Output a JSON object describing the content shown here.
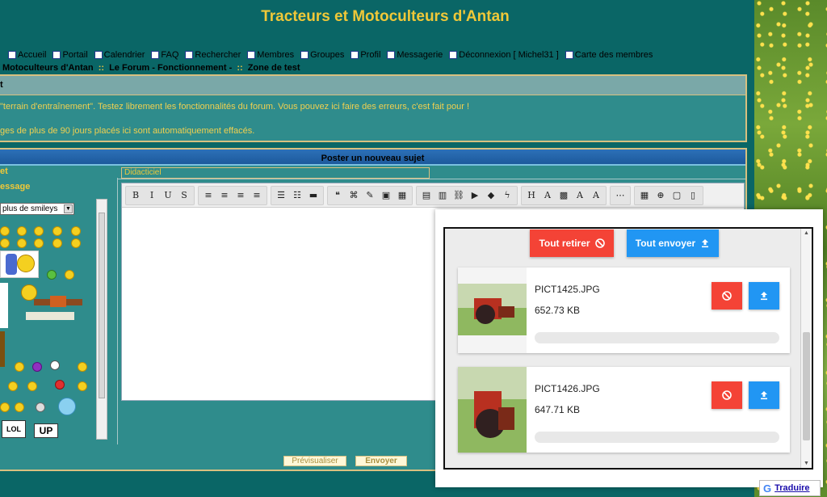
{
  "page": {
    "title": "Tracteurs et Motoculteurs d'Antan"
  },
  "nav": [
    {
      "icon": "home-icon",
      "label": "Accueil"
    },
    {
      "icon": "portal-icon",
      "label": "Portail"
    },
    {
      "icon": "calendar-icon",
      "label": "Calendrier"
    },
    {
      "icon": "faq-icon",
      "label": "FAQ"
    },
    {
      "icon": "search-icon",
      "label": "Rechercher"
    },
    {
      "icon": "members-icon",
      "label": "Membres"
    },
    {
      "icon": "groups-icon",
      "label": "Groupes"
    },
    {
      "icon": "profile-icon",
      "label": "Profil"
    },
    {
      "icon": "mail-icon",
      "label": "Messagerie"
    },
    {
      "icon": "logout-icon",
      "label": "Déconnexion [ Michel31 ]"
    },
    {
      "icon": "globe-icon",
      "label": "Carte des membres"
    }
  ],
  "breadcrumb": {
    "item1": "Motoculteurs d'Antan",
    "item2": "Le Forum - Fonctionnement -",
    "item3": "Zone de test",
    "sep": "::"
  },
  "forum": {
    "head": "t",
    "desc1": "\"terrain d'entraînement\". Testez librement les fonctionnalités du forum. Vous pouvez ici faire des erreurs, c'est fait pour !",
    "desc2": "ges de plus de 90 jours placés ici sont automatiquement effacés."
  },
  "post": {
    "header": "Poster un nouveau sujet",
    "subject_label": "et",
    "message_label": "essage",
    "subject_value": "Didacticiel",
    "smiley_select": "plus de smileys",
    "preview_button": "Prévisualiser",
    "send_button": "Envoyer"
  },
  "toolbar": {
    "groups": [
      [
        {
          "n": "bold-icon",
          "g": "B"
        },
        {
          "n": "italic-icon",
          "g": "I"
        },
        {
          "n": "underline-icon",
          "g": "U"
        },
        {
          "n": "strike-icon",
          "g": "S"
        }
      ],
      [
        {
          "n": "align-left-icon",
          "g": "≡"
        },
        {
          "n": "align-center-icon",
          "g": "≡"
        },
        {
          "n": "align-right-icon",
          "g": "≡"
        },
        {
          "n": "justify-icon",
          "g": "≡"
        }
      ],
      [
        {
          "n": "bullet-list-icon",
          "g": "☰"
        },
        {
          "n": "number-list-icon",
          "g": "☷"
        },
        {
          "n": "hr-icon",
          "g": "▬"
        }
      ],
      [
        {
          "n": "quote-icon",
          "g": "❝"
        },
        {
          "n": "code-icon",
          "g": "⌘"
        },
        {
          "n": "spoiler-icon",
          "g": "✎"
        },
        {
          "n": "hide-icon",
          "g": "▣"
        },
        {
          "n": "table-icon",
          "g": "▦"
        }
      ],
      [
        {
          "n": "image-icon",
          "g": "▤"
        },
        {
          "n": "host-image-icon",
          "g": "▥"
        },
        {
          "n": "link-icon",
          "g": "⛓"
        },
        {
          "n": "youtube-icon",
          "g": "▶"
        },
        {
          "n": "dailymotion-icon",
          "g": "◆"
        },
        {
          "n": "flash-icon",
          "g": "ϟ"
        }
      ],
      [
        {
          "n": "heading-icon",
          "g": "H"
        },
        {
          "n": "font-icon",
          "g": "A"
        },
        {
          "n": "color-icon",
          "g": "▩"
        },
        {
          "n": "font-style-icon",
          "g": "A"
        },
        {
          "n": "clear-format-icon",
          "g": "A"
        }
      ],
      [
        {
          "n": "more-icon",
          "g": "⋯"
        }
      ],
      [
        {
          "n": "date-icon",
          "g": "▦"
        },
        {
          "n": "zoom-icon",
          "g": "⊕"
        },
        {
          "n": "paste-icon",
          "g": "▢"
        },
        {
          "n": "source-icon",
          "g": "▯"
        }
      ]
    ]
  },
  "upload": {
    "remove_all": "Tout retirer",
    "send_all": "Tout envoyer",
    "files": [
      {
        "name": "PICT1425.JPG",
        "size": "652.73 KB",
        "progress": 0
      },
      {
        "name": "PICT1426.JPG",
        "size": "647.71 KB",
        "progress": 0
      }
    ]
  },
  "translate": {
    "label": "Traduire"
  },
  "colors": {
    "red": "#f44336",
    "blue": "#2196f3",
    "teal": "#0a6666",
    "gold": "#f0c838"
  }
}
